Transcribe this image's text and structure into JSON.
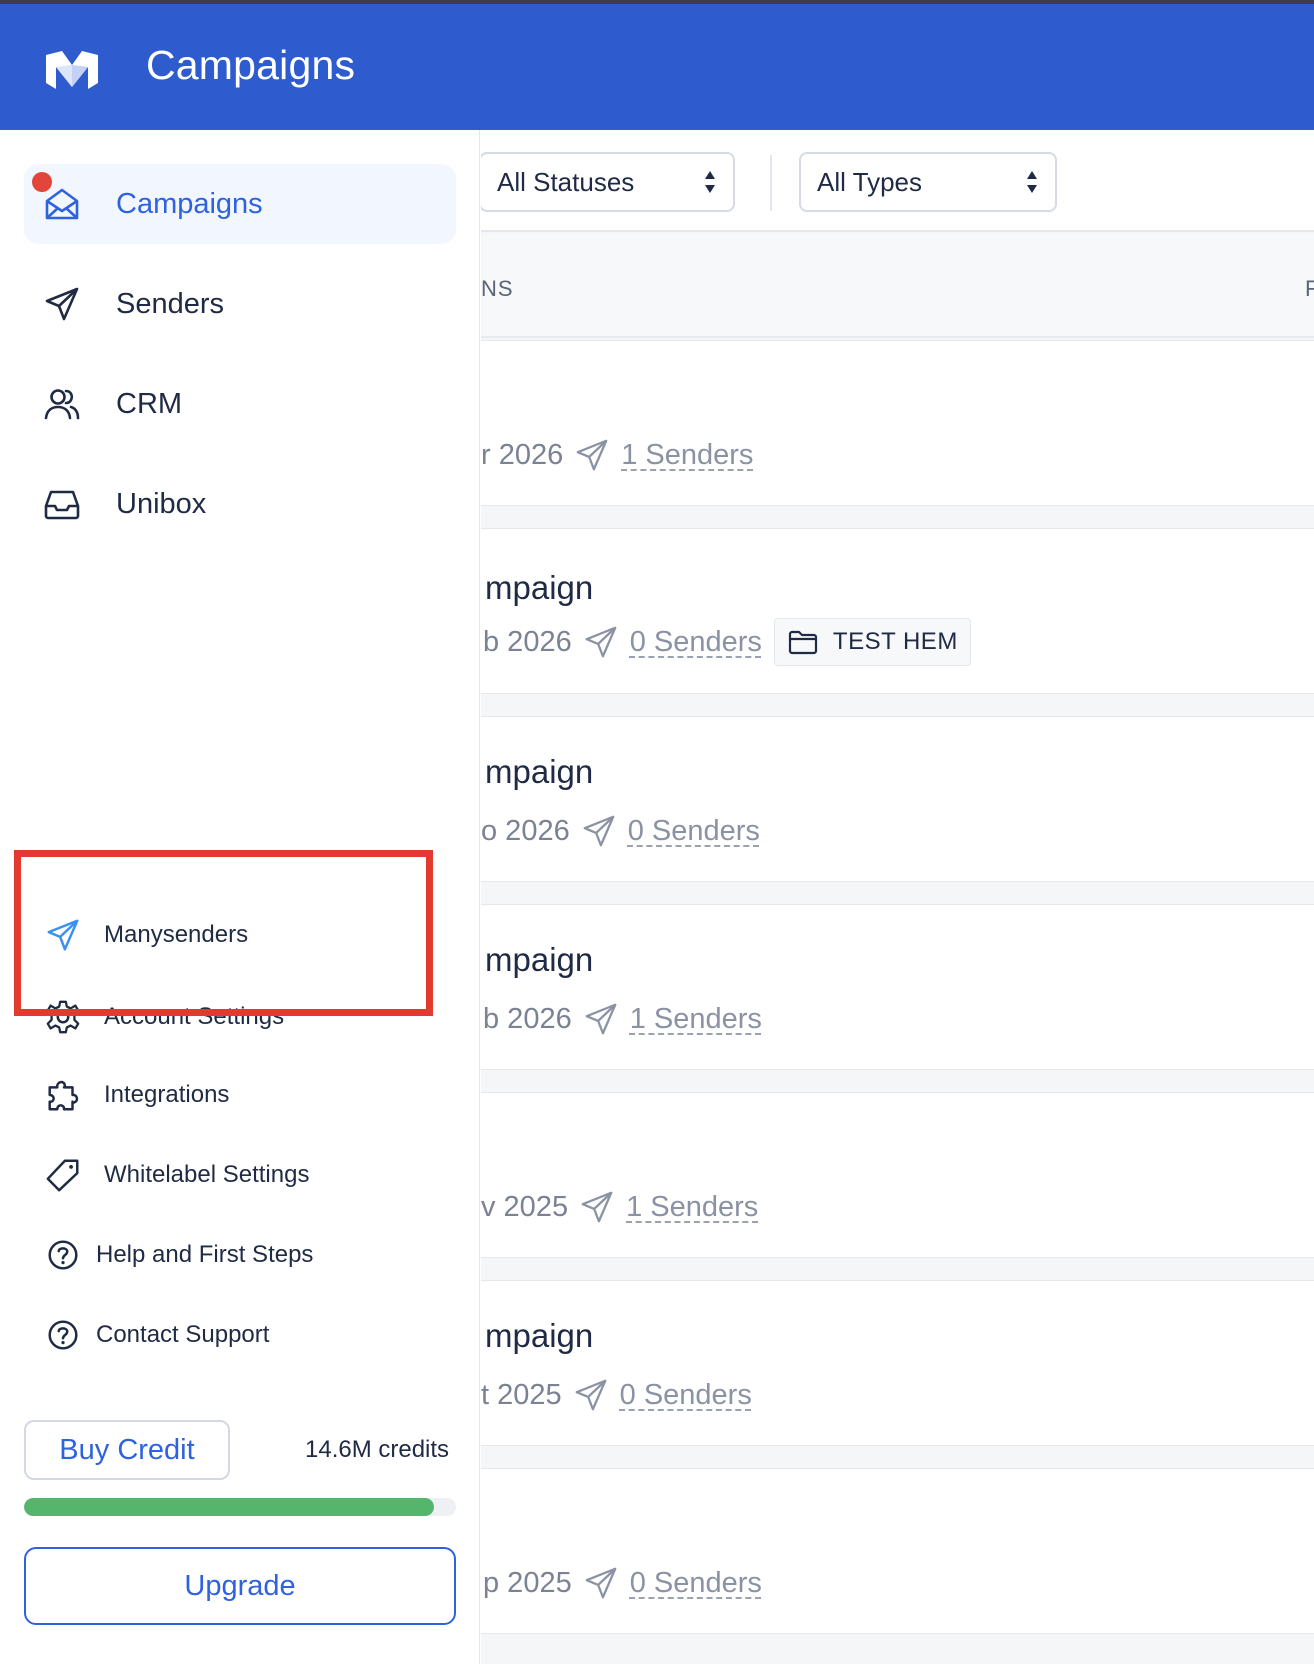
{
  "header": {
    "title": "Campaigns"
  },
  "sidebar": {
    "nav": [
      {
        "label": "Campaigns",
        "icon": "mail-open-icon",
        "active": true
      },
      {
        "label": "Senders",
        "icon": "send-icon"
      },
      {
        "label": "CRM",
        "icon": "users-icon"
      },
      {
        "label": "Unibox",
        "icon": "inbox-icon"
      }
    ],
    "bottom": [
      {
        "label": "Manysenders",
        "icon": "send-icon"
      },
      {
        "label": "Account Settings",
        "icon": "gear-icon"
      },
      {
        "label": "Integrations",
        "icon": "puzzle-icon"
      },
      {
        "label": "Whitelabel Settings",
        "icon": "tag-icon"
      },
      {
        "label": "Help and First Steps",
        "icon": "help-circle-icon"
      },
      {
        "label": "Contact Support",
        "icon": "help-circle-icon"
      }
    ],
    "buy_credit": "Buy Credit",
    "credits": "14.6M credits",
    "credits_progress": 0.95,
    "upgrade": "Upgrade"
  },
  "filters": {
    "status": "All Statuses",
    "type": "All Types"
  },
  "table": {
    "header_left": "NS",
    "header_right": "F",
    "rows": [
      {
        "title": "",
        "date": "r 2026",
        "senders": "1 Senders",
        "tag": ""
      },
      {
        "title": "mpaign",
        "date": "b 2026",
        "senders": "0 Senders",
        "tag": "TEST HEM"
      },
      {
        "title": "mpaign",
        "date": "o 2026",
        "senders": "0 Senders",
        "tag": ""
      },
      {
        "title": "mpaign",
        "date": "b 2026",
        "senders": "1 Senders",
        "tag": ""
      },
      {
        "title": "",
        "date": "v 2025",
        "senders": "1 Senders",
        "tag": ""
      },
      {
        "title": "mpaign",
        "date": "t 2025",
        "senders": "0 Senders",
        "tag": ""
      },
      {
        "title": "",
        "date": "p 2025",
        "senders": "0 Senders",
        "tag": ""
      }
    ]
  },
  "colors": {
    "brand": "#2e5bce",
    "accent": "#2f62e0",
    "highlight_box": "#e23a2e",
    "progress": "#55b56c",
    "notification_dot": "#e2463a"
  }
}
